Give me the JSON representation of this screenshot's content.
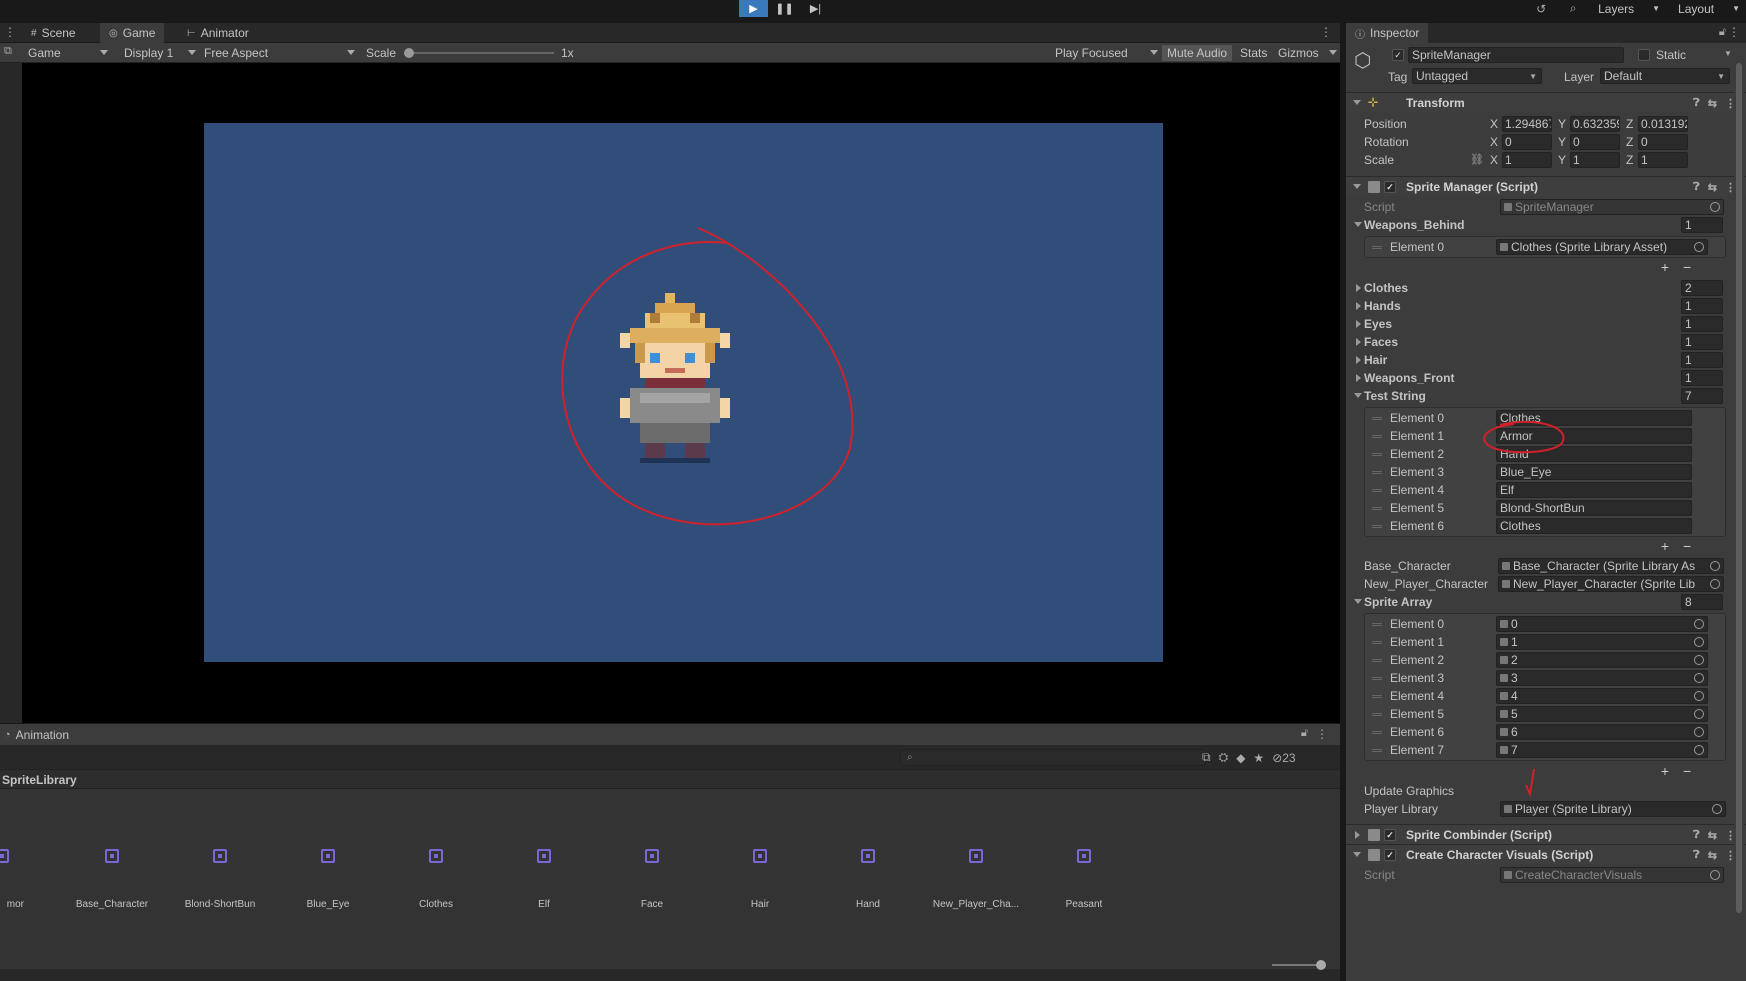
{
  "toolbar": {
    "layers_label": "Layers",
    "layout_label": "Layout"
  },
  "game_panel": {
    "tabs": [
      {
        "label": "Scene"
      },
      {
        "label": "Game"
      },
      {
        "label": "Animator"
      }
    ],
    "display_mode": "Game",
    "display": "Display 1",
    "aspect": "Free Aspect",
    "scale_label": "Scale",
    "scale_value": "1x",
    "play_focused": "Play Focused",
    "mute_audio": "Mute Audio",
    "stats": "Stats",
    "gizmos": "Gizmos"
  },
  "animation_panel": {
    "title": "Animation",
    "asset_folder": "SpriteLibrary",
    "hidden_count": "23",
    "assets": [
      {
        "label": "mor"
      },
      {
        "label": "Base_Character"
      },
      {
        "label": "Blond-ShortBun"
      },
      {
        "label": "Blue_Eye"
      },
      {
        "label": "Clothes"
      },
      {
        "label": "Elf"
      },
      {
        "label": "Face"
      },
      {
        "label": "Hair"
      },
      {
        "label": "Hand"
      },
      {
        "label": "New_Player_Cha..."
      },
      {
        "label": "Peasant"
      }
    ]
  },
  "inspector": {
    "tab_label": "Inspector",
    "object_name": "SpriteManager",
    "static_label": "Static",
    "tag_label": "Tag",
    "tag_value": "Untagged",
    "layer_label": "Layer",
    "layer_value": "Default",
    "transform": {
      "title": "Transform",
      "position_label": "Position",
      "rotation_label": "Rotation",
      "scale_label": "Scale",
      "position": {
        "x": "1.294867",
        "y": "0.632359",
        "z": "0.013192"
      },
      "rotation": {
        "x": "0",
        "y": "0",
        "z": "0"
      },
      "scale": {
        "x": "1",
        "y": "1",
        "z": "1"
      }
    },
    "sprite_manager": {
      "title": "Sprite Manager (Script)",
      "script_label": "Script",
      "script_value": "SpriteManager",
      "weapons_behind": {
        "label": "Weapons_Behind",
        "size": "1",
        "elements": [
          {
            "label": "Element 0",
            "value": "Clothes (Sprite Library Asset)"
          }
        ]
      },
      "collapsed_lists": [
        {
          "label": "Clothes",
          "size": "2"
        },
        {
          "label": "Hands",
          "size": "1"
        },
        {
          "label": "Eyes",
          "size": "1"
        },
        {
          "label": "Faces",
          "size": "1"
        },
        {
          "label": "Hair",
          "size": "1"
        },
        {
          "label": "Weapons_Front",
          "size": "1"
        }
      ],
      "test_string": {
        "label": "Test String",
        "size": "7",
        "elements": [
          {
            "label": "Element 0",
            "value": "Clothes"
          },
          {
            "label": "Element 1",
            "value": "Armor"
          },
          {
            "label": "Element 2",
            "value": "Hand"
          },
          {
            "label": "Element 3",
            "value": "Blue_Eye"
          },
          {
            "label": "Element 4",
            "value": "Elf"
          },
          {
            "label": "Element 5",
            "value": "Blond-ShortBun"
          },
          {
            "label": "Element 6",
            "value": "Clothes"
          }
        ]
      },
      "base_character_label": "Base_Character",
      "base_character_value": "Base_Character (Sprite Library As",
      "new_player_label": "New_Player_Character",
      "new_player_value": "New_Player_Character (Sprite Lib",
      "sprite_array": {
        "label": "Sprite Array",
        "size": "8",
        "elements": [
          {
            "label": "Element 0",
            "value": "0"
          },
          {
            "label": "Element 1",
            "value": "1"
          },
          {
            "label": "Element 2",
            "value": "2"
          },
          {
            "label": "Element 3",
            "value": "3"
          },
          {
            "label": "Element 4",
            "value": "4"
          },
          {
            "label": "Element 5",
            "value": "5"
          },
          {
            "label": "Element 6",
            "value": "6"
          },
          {
            "label": "Element 7",
            "value": "7"
          }
        ]
      },
      "update_graphics_label": "Update Graphics",
      "player_library_label": "Player Library",
      "player_library_value": "Player (Sprite Library)"
    },
    "sprite_combinder_title": "Sprite Combinder (Script)",
    "create_visuals_title": "Create Character Visuals (Script)",
    "create_visuals_script_label": "Script",
    "create_visuals_script_value": "CreateCharacterVisuals"
  },
  "annotation_color": "#d0212b",
  "accent_color": "#3a79bb",
  "game_bg_color": "#314d79"
}
